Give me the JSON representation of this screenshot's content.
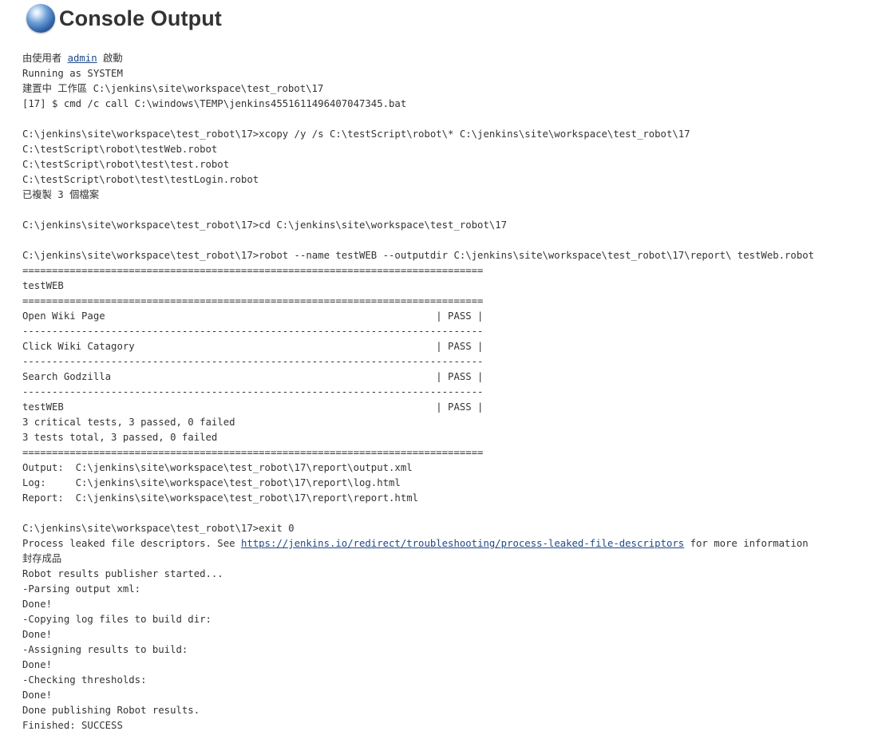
{
  "header": {
    "title": "Console Output",
    "icon": "console-orb-icon"
  },
  "console": {
    "start_prefix": "由使用者 ",
    "start_user": "admin",
    "start_suffix": " 啟動",
    "leak_prefix": "Process leaked file descriptors. See ",
    "leak_link": "https://jenkins.io/redirect/troubleshooting/process-leaked-file-descriptors",
    "leak_suffix": " for more information",
    "lines": [
      "Running as SYSTEM",
      "建置中 工作區 C:\\jenkins\\site\\workspace\\test_robot\\17",
      "[17] $ cmd /c call C:\\windows\\TEMP\\jenkins4551611496407047345.bat",
      "",
      "C:\\jenkins\\site\\workspace\\test_robot\\17>xcopy /y /s C:\\testScript\\robot\\* C:\\jenkins\\site\\workspace\\test_robot\\17",
      "C:\\testScript\\robot\\testWeb.robot",
      "C:\\testScript\\robot\\test\\test.robot",
      "C:\\testScript\\robot\\test\\testLogin.robot",
      "已複製 3 個檔案",
      "",
      "C:\\jenkins\\site\\workspace\\test_robot\\17>cd C:\\jenkins\\site\\workspace\\test_robot\\17",
      "",
      "C:\\jenkins\\site\\workspace\\test_robot\\17>robot --name testWEB --outputdir C:\\jenkins\\site\\workspace\\test_robot\\17\\report\\ testWeb.robot",
      "==============================================================================",
      "testWEB",
      "==============================================================================",
      "Open Wiki Page                                                        | PASS |",
      "------------------------------------------------------------------------------",
      "Click Wiki Catagory                                                   | PASS |",
      "------------------------------------------------------------------------------",
      "Search Godzilla                                                       | PASS |",
      "------------------------------------------------------------------------------",
      "testWEB                                                               | PASS |",
      "3 critical tests, 3 passed, 0 failed",
      "3 tests total, 3 passed, 0 failed",
      "==============================================================================",
      "Output:  C:\\jenkins\\site\\workspace\\test_robot\\17\\report\\output.xml",
      "Log:     C:\\jenkins\\site\\workspace\\test_robot\\17\\report\\log.html",
      "Report:  C:\\jenkins\\site\\workspace\\test_robot\\17\\report\\report.html",
      "",
      "C:\\jenkins\\site\\workspace\\test_robot\\17>exit 0"
    ],
    "tail_lines": [
      "封存成品",
      "Robot results publisher started...",
      "-Parsing output xml:",
      "Done!",
      "-Copying log files to build dir:",
      "Done!",
      "-Assigning results to build:",
      "Done!",
      "-Checking thresholds:",
      "Done!",
      "Done publishing Robot results.",
      "Finished: SUCCESS"
    ]
  }
}
